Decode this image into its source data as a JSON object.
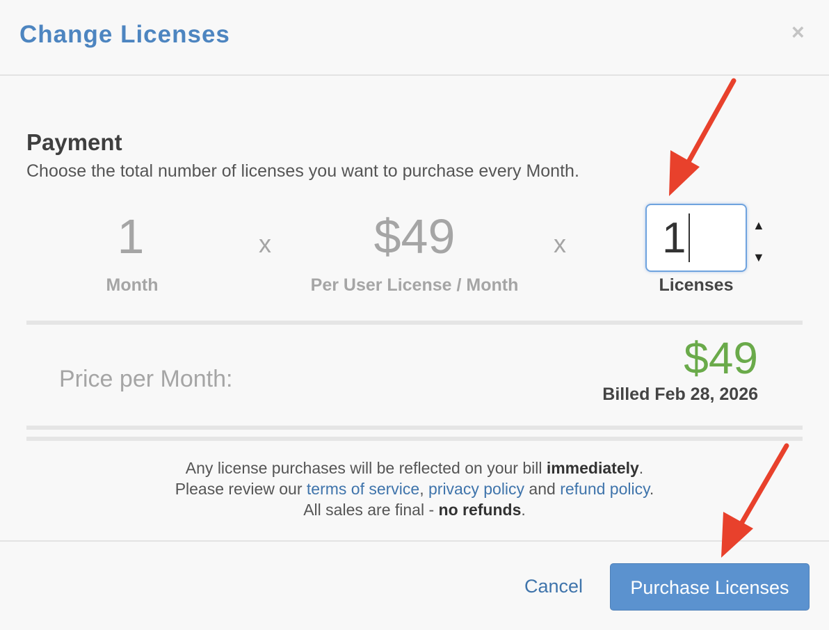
{
  "dialog": {
    "title": "Change Licenses",
    "close_symbol": "×"
  },
  "payment": {
    "heading": "Payment",
    "description": "Choose the total number of licenses you want to purchase every Month.",
    "months_value": "1",
    "months_label": "Month",
    "multiply_symbol": "x",
    "price_value": "$49",
    "price_label": "Per User License / Month",
    "licenses_input_value": "1",
    "licenses_label": "Licenses",
    "spin_up": "▲",
    "spin_down": "▼"
  },
  "total": {
    "label": "Price per Month:",
    "value": "$49",
    "billed": "Billed Feb 28, 2026"
  },
  "notice": {
    "line1_text": "Any license purchases will be reflected on your bill ",
    "line1_bold": "immediately",
    "line1_end": ".",
    "line2_text": "Please review our ",
    "terms_link": "terms of service",
    "comma": ", ",
    "privacy_link": "privacy policy",
    "and_text": " and ",
    "refund_link": "refund policy",
    "line2_end": ".",
    "line3_text": "All sales are final - ",
    "line3_bold": "no refunds",
    "line3_end": "."
  },
  "footer": {
    "cancel_label": "Cancel",
    "purchase_label": "Purchase Licenses"
  },
  "colors": {
    "title": "#4d85c0",
    "price_total": "#6aaa4a",
    "button": "#5b92cf",
    "link": "#3f74ab",
    "annotation_arrow": "#e8412c"
  }
}
